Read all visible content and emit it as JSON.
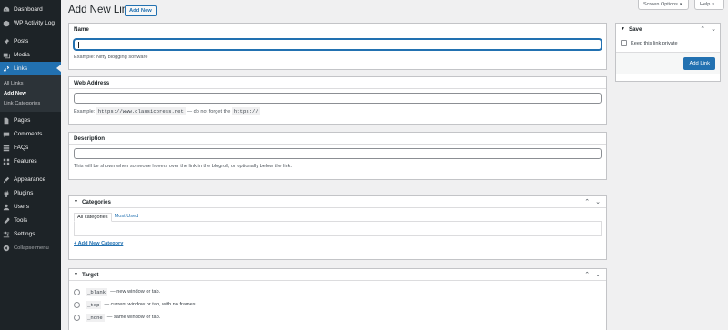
{
  "sidebar": {
    "items": [
      {
        "label": "Dashboard",
        "icon": "dashboard-icon"
      },
      {
        "label": "WP Activity Log",
        "icon": "activity-log-icon"
      },
      {
        "label": "Posts",
        "icon": "pin-icon"
      },
      {
        "label": "Media",
        "icon": "media-icon"
      },
      {
        "label": "Links",
        "icon": "links-icon"
      },
      {
        "label": "Pages",
        "icon": "pages-icon"
      },
      {
        "label": "Comments",
        "icon": "comments-icon"
      },
      {
        "label": "FAQs",
        "icon": "faqs-icon"
      },
      {
        "label": "Features",
        "icon": "features-icon"
      },
      {
        "label": "Appearance",
        "icon": "appearance-icon"
      },
      {
        "label": "Plugins",
        "icon": "plugins-icon"
      },
      {
        "label": "Users",
        "icon": "users-icon"
      },
      {
        "label": "Tools",
        "icon": "tools-icon"
      },
      {
        "label": "Settings",
        "icon": "settings-icon"
      }
    ],
    "submenu": [
      "All Links",
      "Add New",
      "Link Categories"
    ],
    "collapse_label": "Collapse menu"
  },
  "topbar": {
    "screen_options": "Screen Options",
    "help": "Help"
  },
  "page": {
    "title": "Add New Link",
    "add_new": "Add New"
  },
  "name_box": {
    "title": "Name",
    "value": "",
    "help": "Example: Nifty blogging software"
  },
  "web_box": {
    "title": "Web Address",
    "value": "",
    "help_prefix": "Example:",
    "help_code1": "https://www.classicpress.net",
    "help_middle": "— do not forget the",
    "help_code2": "https://"
  },
  "desc_box": {
    "title": "Description",
    "value": "",
    "help": "This will be shown when someone hovers over the link in the blogroll, or optionally below the link."
  },
  "categories_box": {
    "title": "Categories",
    "tab_all": "All categories",
    "tab_most_used": "Most Used",
    "add_new": "+ Add New Category"
  },
  "target_box": {
    "title": "Target",
    "options": [
      {
        "code": "_blank",
        "desc": "— new window or tab."
      },
      {
        "code": "_top",
        "desc": "— current window or tab, with no frames."
      },
      {
        "code": "_none",
        "desc": "— same window or tab."
      }
    ]
  },
  "save_box": {
    "title": "Save",
    "private_label": "Keep this link private",
    "add_link": "Add Link"
  },
  "colors": {
    "sidebar_bg": "#1d2327",
    "accent": "#2271b1",
    "page_bg": "#f0f0f1"
  }
}
